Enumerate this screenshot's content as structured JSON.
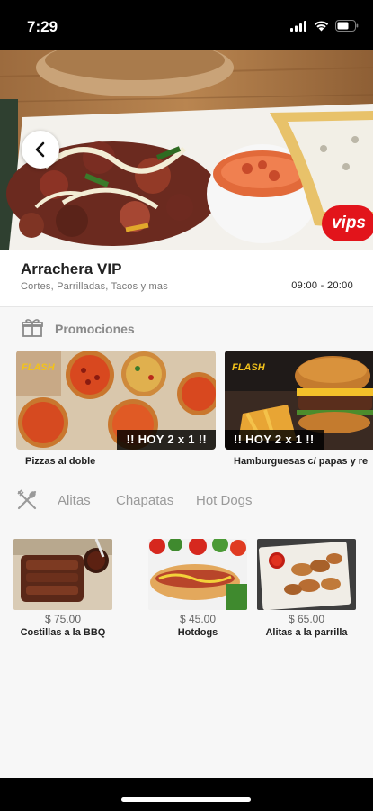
{
  "status_bar": {
    "time": "7:29"
  },
  "restaurant": {
    "name": "Arrachera VIP",
    "categories": "Cortes, Parrilladas, Tacos y mas",
    "hours": "09:00 - 20:00",
    "brand_logo_text": "vips"
  },
  "promotions": {
    "section_label": "Promociones",
    "items": [
      {
        "caption": "Pizzas al doble",
        "ribbon": "!! HOY 2 x 1 !!",
        "brand_text": "FLASH"
      },
      {
        "caption": "Hamburguesas c/ papas y re",
        "ribbon": "!! HOY 2 x 1 !!",
        "brand_text": "FLASH"
      }
    ]
  },
  "menu": {
    "tabs": [
      "Alitas",
      "Chapatas",
      "Hot Dogs"
    ],
    "dishes": [
      {
        "price": "$ 75.00",
        "name": "Costillas a la BBQ"
      },
      {
        "price": "$ 45.00",
        "name": "Hotdogs"
      },
      {
        "price": "$ 65.00",
        "name": "Alitas a la parrilla"
      }
    ]
  },
  "colors": {
    "brand_red": "#e2141b",
    "muted_text": "#8a8a8a",
    "background": "#f7f7f7"
  },
  "icons": [
    "back-arrow-icon",
    "gift-box-icon",
    "cutlery-icon",
    "signal-icon",
    "wifi-icon",
    "battery-icon"
  ]
}
